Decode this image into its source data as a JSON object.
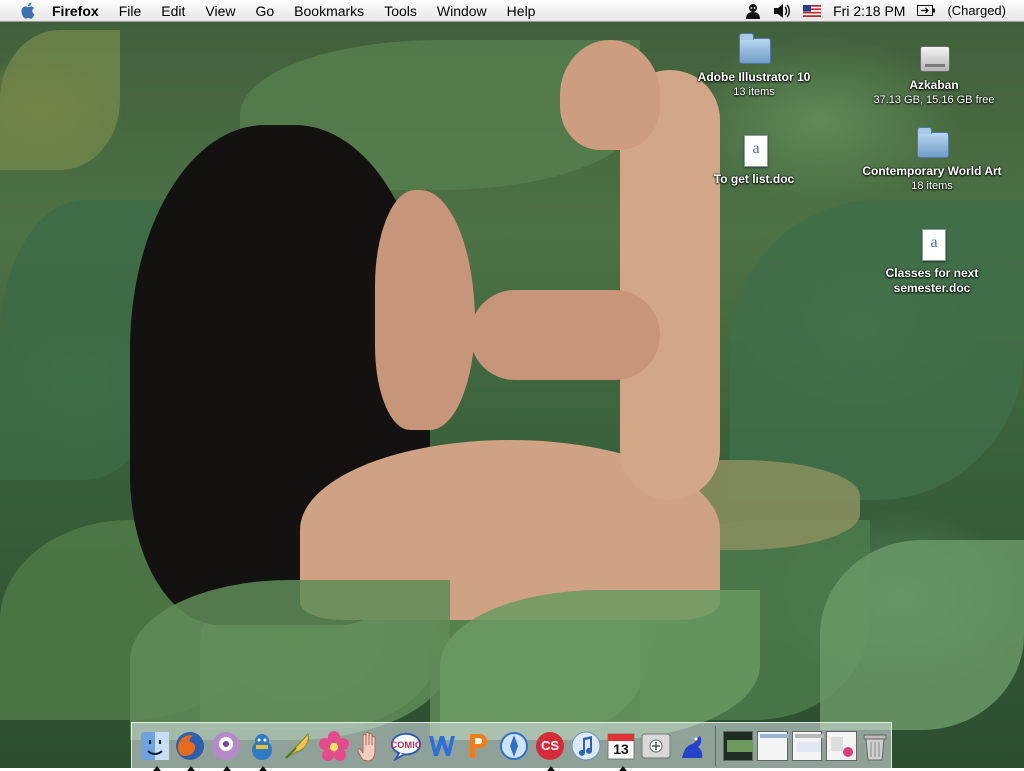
{
  "menubar": {
    "app_name": "Firefox",
    "menus": [
      "File",
      "Edit",
      "View",
      "Go",
      "Bookmarks",
      "Tools",
      "Window",
      "Help"
    ],
    "clock": "Fri 2:18 PM",
    "battery": "(Charged)",
    "icons": [
      "apple-icon",
      "user-icon",
      "volume-icon",
      "us-flag-icon",
      "battery-icon"
    ]
  },
  "desktop": {
    "icons": [
      {
        "label": "Adobe Illustrator 10",
        "sub": "13 items",
        "kind": "folder"
      },
      {
        "label": "To get list.doc",
        "sub": "",
        "kind": "document"
      },
      {
        "label": "Azkaban",
        "sub": "37.13 GB, 15.16 GB free",
        "kind": "hard-drive"
      },
      {
        "label": "Contemporary World Art",
        "sub": "18 items",
        "kind": "folder"
      },
      {
        "label": "Classes for next semester.doc",
        "sub": "",
        "kind": "document"
      }
    ]
  },
  "dock": {
    "apps": [
      {
        "name": "finder-icon",
        "running": true
      },
      {
        "name": "firefox-icon",
        "running": true
      },
      {
        "name": "itunes-purple-icon",
        "running": true
      },
      {
        "name": "adium-duck-icon",
        "running": true
      },
      {
        "name": "feather-pen-icon",
        "running": false
      },
      {
        "name": "pink-flower-icon",
        "running": false
      },
      {
        "name": "hand-icon",
        "running": false
      },
      {
        "name": "comic-life-icon",
        "running": false
      },
      {
        "name": "word-icon",
        "running": false
      },
      {
        "name": "powerpoint-icon",
        "running": false
      },
      {
        "name": "safari-icon",
        "running": false
      },
      {
        "name": "creative-suite-icon",
        "running": true
      },
      {
        "name": "itunes-icon",
        "running": false
      },
      {
        "name": "ical-icon",
        "running": true
      },
      {
        "name": "system-preferences-icon",
        "running": false
      },
      {
        "name": "frog-icon",
        "running": false
      }
    ],
    "ical_day": "13",
    "cs_label": "CS",
    "minimized": [
      "window-thumb-1",
      "window-thumb-2",
      "window-thumb-3",
      "window-thumb-4",
      "trash-icon"
    ]
  }
}
